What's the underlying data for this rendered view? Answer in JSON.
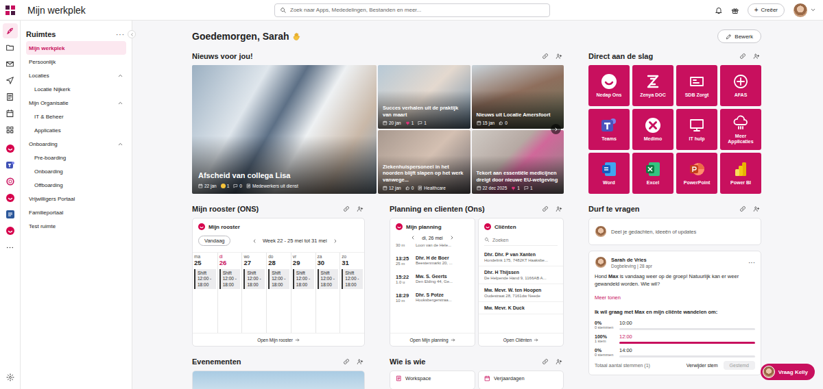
{
  "app": {
    "title": "Mijn werkplek"
  },
  "search": {
    "placeholder": "Zoek naar Apps, Mededelingen, Bestanden en meer..."
  },
  "create_button": {
    "icon": "+",
    "label": "Creëer"
  },
  "rail": {
    "items": [
      {
        "selected": true
      },
      {
        "selected": false
      },
      {
        "selected": false
      },
      {
        "selected": false
      },
      {
        "selected": false
      },
      {
        "selected": false
      },
      {
        "selected": false
      },
      {
        "selected": false
      },
      {
        "selected": false
      },
      {
        "selected": false
      },
      {
        "selected": false
      },
      {
        "selected": false
      },
      {
        "selected": false
      },
      {
        "selected": false
      }
    ],
    "settings": {
      "selected": false
    }
  },
  "sidebar": {
    "title": "Ruimtes",
    "more": "···",
    "items": [
      {
        "label": "Mijn werkplek",
        "kind": "item",
        "selected": true
      },
      {
        "label": "Persoonlijk",
        "kind": "item",
        "selected": false
      },
      {
        "label": "Locaties",
        "kind": "group",
        "expanded": true,
        "selected": false
      },
      {
        "label": "Locatie Nijkerk",
        "kind": "child",
        "selected": false
      },
      {
        "label": "Mijn Organisatie",
        "kind": "group",
        "expanded": true,
        "selected": false
      },
      {
        "label": "IT & Beheer",
        "kind": "child",
        "selected": false
      },
      {
        "label": "Applicaties",
        "kind": "child",
        "selected": false
      },
      {
        "label": "Onboarding",
        "kind": "group",
        "expanded": true,
        "selected": false
      },
      {
        "label": "Pre-boarding",
        "kind": "child",
        "selected": false
      },
      {
        "label": "Onboarding",
        "kind": "child",
        "selected": false
      },
      {
        "label": "Offboarding",
        "kind": "child",
        "selected": false
      },
      {
        "label": "Vrijwilligers Portaal",
        "kind": "item",
        "selected": false
      },
      {
        "label": "Familieportaal",
        "kind": "item",
        "selected": false
      },
      {
        "label": "Test ruimte",
        "kind": "item",
        "selected": false
      }
    ]
  },
  "greeting": "Goedemorgen, Sarah",
  "edit_button": "Bewerk",
  "news": {
    "title": "Nieuws voor jou!",
    "items": [
      {
        "title": "Afscheid van collega Lisa",
        "date": "22 jan",
        "reaction": "emoji",
        "reactions": "1",
        "comments": "0",
        "tag": "Medewerkers uit dienst"
      },
      {
        "title": "Succes verhalen uit de praktijk van maart",
        "date": "20 jan",
        "reaction": "heart",
        "reactions": "1",
        "comments": "1"
      },
      {
        "title": "Nieuws uit Locatie Amersfoort",
        "date": "15 jan",
        "reaction": "thumb",
        "reactions": "0"
      },
      {
        "title": "Ziekenhuispersoneel in het noorden blijft slapen op het werk vanwege...",
        "date": "12 jan",
        "reaction": "thumb",
        "reactions": "0",
        "tag": "Healthcare"
      },
      {
        "title": "Tekort aan essentiële medicijnen dreigt door nieuwe EU-wetgeving",
        "date": "22 dec 2025",
        "reaction": "heart",
        "reactions": "1",
        "comments": "1"
      }
    ]
  },
  "direct": {
    "title": "Direct aan de slag",
    "tiles": [
      {
        "label": "Nedap Ons"
      },
      {
        "label": "Zenya DOC"
      },
      {
        "label": "SDB Zorgt"
      },
      {
        "label": "AFAS"
      },
      {
        "label": "Teams"
      },
      {
        "label": "Medimo"
      },
      {
        "label": "IT hulp"
      },
      {
        "label": "Meer Applicaties"
      },
      {
        "label": "Word"
      },
      {
        "label": "Excel"
      },
      {
        "label": "PowerPoint"
      },
      {
        "label": "Power BI"
      }
    ]
  },
  "rooster": {
    "title": "Mijn rooster (ONS)",
    "card_title": "Mijn rooster",
    "today": "Vandaag",
    "week": "Week 22 - 25 mei tot 31 mei",
    "days": [
      {
        "dow": "ma",
        "day": "25",
        "selected": false,
        "shift": "Shift",
        "time": "12:00 - 18:00"
      },
      {
        "dow": "di",
        "day": "26",
        "selected": true,
        "shift": "Shift",
        "time": "12:00 - 18:00"
      },
      {
        "dow": "wo",
        "day": "27",
        "selected": false,
        "shift": "Shift",
        "time": "12:00 - 18:00"
      },
      {
        "dow": "do",
        "day": "28",
        "selected": false,
        "shift": "Shift",
        "time": "12:00 - 18:00"
      },
      {
        "dow": "vr",
        "day": "29",
        "selected": false,
        "shift": "Shift",
        "time": "12:00 - 18:00"
      },
      {
        "dow": "za",
        "day": "30",
        "selected": false,
        "shift": "Shift",
        "time": "12:00 - 18:00"
      },
      {
        "dow": "zo",
        "day": "31",
        "selected": false,
        "shift": "Shift",
        "time": "12:00 - 18:00"
      }
    ],
    "open": "Open Mijn rooster"
  },
  "planning": {
    "title": "Planning en clienten (Ons)",
    "card_title": "Mijn planning",
    "date": "di, 26 mei",
    "appointments": [
      {
        "duration": "30 m",
        "address": "Loon van de Hele..."
      },
      {
        "time": "13:25",
        "duration": "25 m",
        "name": "Dhr. H de Boer",
        "address": "Beestenmarkt 20, ..."
      },
      {
        "time": "15:22",
        "duration": "1.0 u",
        "name": "Mw. S. Geerts",
        "address": "Den Elding 44, Ge..."
      },
      {
        "time": "18:29",
        "duration": "10 m",
        "name": "Dhr. S Potze",
        "address": "Hooksbergerstraa..."
      }
    ],
    "open": "Open Mijn planning"
  },
  "clients": {
    "card_title": "Cliënten",
    "search_placeholder": "Zoeken",
    "items": [
      {
        "name": "Dhr. Dhr. P van Xanten",
        "address": "Hondelink 175, 7482KT Haaksbe..."
      },
      {
        "name": "Dhr. H Thijssen",
        "address": "De Helpende Hand 9, 1166AB A..."
      },
      {
        "name": "Mw. Mevr. W. ten Hoopen",
        "address": "Oudestraat 28, 7161dw Neede"
      },
      {
        "name": "Mw. Mevr. K Duck"
      }
    ],
    "open": "Open Cliënten"
  },
  "durf": {
    "title": "Durf te vragen",
    "composer": "Deel je gedachten, ideeën of updates",
    "post": {
      "author": "Sarah de Vries",
      "meta": "Dogbeleving | 28 apr",
      "more": "···",
      "text": [
        {
          "text": "Hond ",
          "bold": false
        },
        {
          "text": "Max",
          "bold": true
        },
        {
          "text": " is vandaag weer op de groep! Natuurlijk kan er weer gewandeld worden. Wie wil?",
          "bold": false
        }
      ],
      "more_link": "Meer tonen",
      "poll": {
        "question": "Ik wil graag met Max en mijn cliënte wandelen om:",
        "options": [
          {
            "percent": "0%",
            "votes": "0 stemmen",
            "label": "10:00",
            "level": 0,
            "selected": false
          },
          {
            "percent": "100%",
            "votes": "1 stem",
            "label": "12:00",
            "level": 1,
            "selected": true
          },
          {
            "percent": "0%",
            "votes": "0 stemmen",
            "label": "14:00",
            "level": 0,
            "selected": false
          }
        ],
        "total": "Totaal aantal stemmen (1)",
        "remove": "Verwijder stem",
        "voted": {
          "label": "Gestemd",
          "disabled": true
        }
      }
    }
  },
  "events": {
    "title": "Evenementen"
  },
  "wie": {
    "title": "Wie is wie",
    "cards": [
      {
        "label": "Workspace"
      },
      {
        "label": "Verjaardagen"
      }
    ]
  },
  "kelly": {
    "label": "Vraag Kelly"
  }
}
